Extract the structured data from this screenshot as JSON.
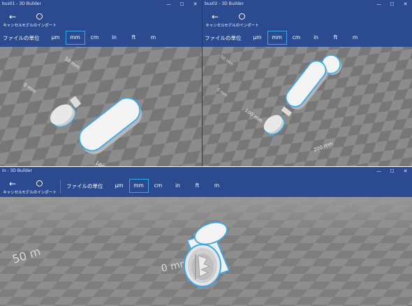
{
  "windows": [
    {
      "id": "w1",
      "title": "bus01 - 3D Builder",
      "commands": [
        {
          "icon": "back-arrow-icon",
          "label": "キャンセル"
        },
        {
          "icon": "circle-icon",
          "label": "モデルのインポート"
        }
      ],
      "units_label": "ファイルの単位",
      "units": [
        "µm",
        "mm",
        "cm",
        "in",
        "ft",
        "m"
      ],
      "selected_unit": "mm",
      "ruler_labels": [
        "50 mm",
        "0 mm",
        "100"
      ]
    },
    {
      "id": "w2",
      "title": "bus02 - 3D Builder",
      "commands": [
        {
          "icon": "back-arrow-icon",
          "label": "キャンセル"
        },
        {
          "icon": "circle-icon",
          "label": "モデルのインポート"
        }
      ],
      "units_label": "ファイルの単位",
      "units": [
        "µm",
        "mm",
        "cm",
        "in",
        "ft",
        "m"
      ],
      "selected_unit": "mm",
      "ruler_labels": [
        "50 mm",
        "0 mm",
        "100 mm",
        "200 mm"
      ]
    },
    {
      "id": "w3",
      "title": "in - 3D Builder",
      "commands": [
        {
          "icon": "back-arrow-icon",
          "label": "キャンセル"
        },
        {
          "icon": "circle-icon",
          "label": "モデルのインポート"
        }
      ],
      "units_label": "ファイルの単位",
      "units": [
        "µm",
        "mm",
        "cm",
        "in",
        "ft",
        "m"
      ],
      "selected_unit": "mm",
      "ruler_labels": [
        "50 m",
        "0 mm"
      ]
    }
  ],
  "window_controls": [
    "—",
    "☐",
    "✕"
  ],
  "colors": {
    "titlebar": "#2b4a90",
    "selection": "#3aa8f0",
    "floor_dark": "#6a6a6a",
    "floor_light": "#8a8a8a"
  }
}
